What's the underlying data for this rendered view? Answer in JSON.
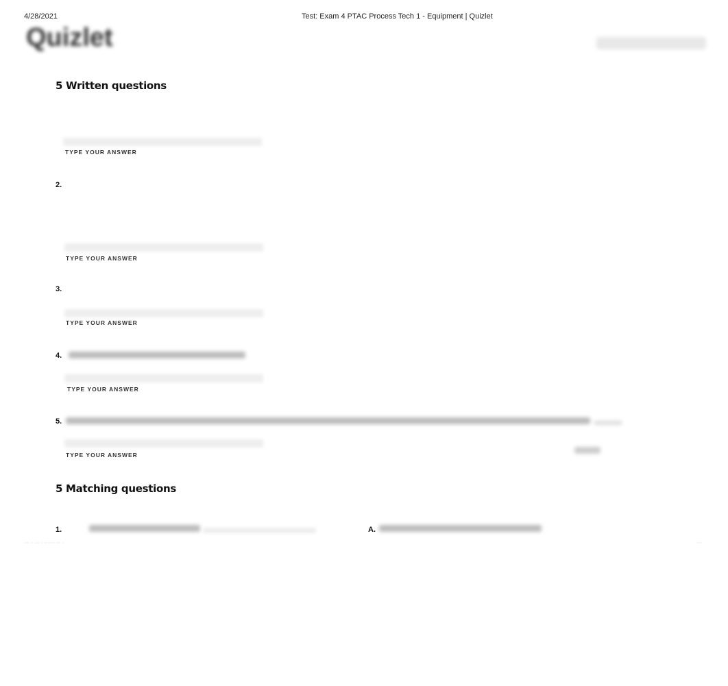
{
  "header": {
    "date": "4/28/2021",
    "title": "Test: Exam 4 PTAC Process Tech 1 - Equipment | Quizlet"
  },
  "logo": "Quizlet",
  "written": {
    "title": "5 Written questions",
    "answer_label": "TYPE YOUR ANSWER",
    "questions": [
      {
        "number": ""
      },
      {
        "number": "2."
      },
      {
        "number": "3."
      },
      {
        "number": "4."
      },
      {
        "number": "5."
      }
    ]
  },
  "matching": {
    "title": "5 Matching questions",
    "items": [
      {
        "number": "1.",
        "letter": "A."
      }
    ]
  }
}
